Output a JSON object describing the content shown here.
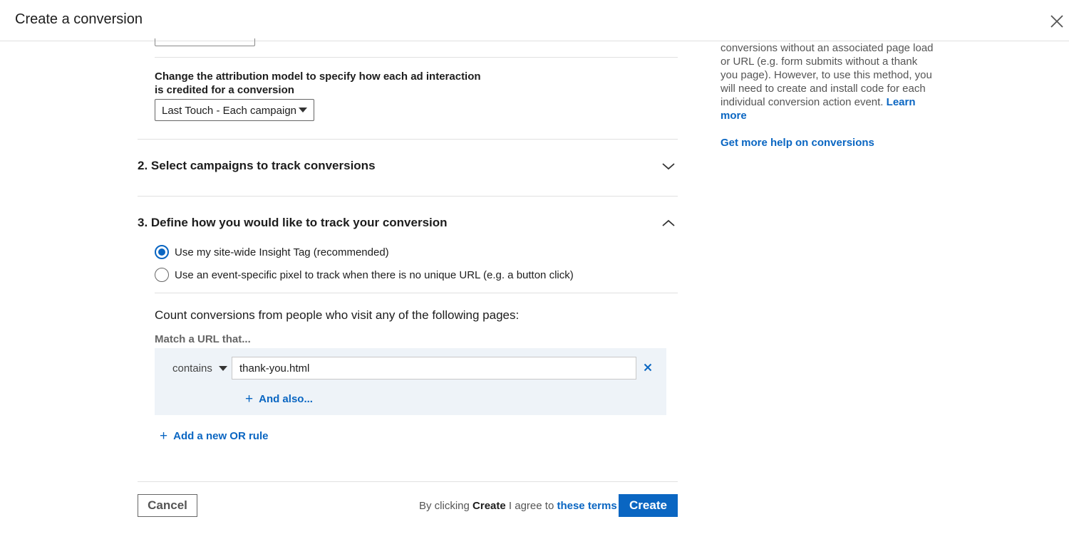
{
  "header": {
    "title": "Create a conversion"
  },
  "attribution": {
    "label": "Change the attribution model to specify how each ad interaction is credited for a conversion",
    "selected": "Last Touch - Each campaign"
  },
  "sections": {
    "campaigns": {
      "title": "2. Select campaigns to track conversions",
      "expanded": false
    },
    "tracking": {
      "title": "3. Define how you would like to track your conversion",
      "expanded": true
    }
  },
  "tracking": {
    "options": [
      {
        "label": "Use my site-wide Insight Tag (recommended)",
        "selected": true
      },
      {
        "label": "Use an event-specific pixel to track when there is no unique URL (e.g. a button click)",
        "selected": false
      }
    ],
    "count_label": "Count conversions from people who visit any of the following pages:",
    "match_label": "Match a URL that...",
    "rule": {
      "operator": "contains",
      "value": "thank-you.html"
    },
    "and_also": "And also...",
    "add_or_rule": "Add a new OR rule"
  },
  "footer": {
    "cancel": "Cancel",
    "terms_prefix": "By clicking",
    "terms_bold": "Create",
    "terms_middle": "I agree to",
    "terms_link": "these terms",
    "create": "Create"
  },
  "sidebar": {
    "text": "conversions without an associated page load or URL (e.g. form submits without a thank you page). However, to use this method, you will need to create and install code for each individual conversion action event.",
    "learn_more": "Learn more",
    "help_link": "Get more help on conversions"
  },
  "colors": {
    "accent": "#0a66c2",
    "panel": "#eef3f8",
    "divider": "#e0e0e0"
  },
  "icons": {
    "close": "close-icon",
    "expand": "chevron-down-icon",
    "collapse": "chevron-up-icon",
    "remove": "x-icon",
    "add": "plus-icon",
    "dropdown": "caret-down-icon"
  }
}
